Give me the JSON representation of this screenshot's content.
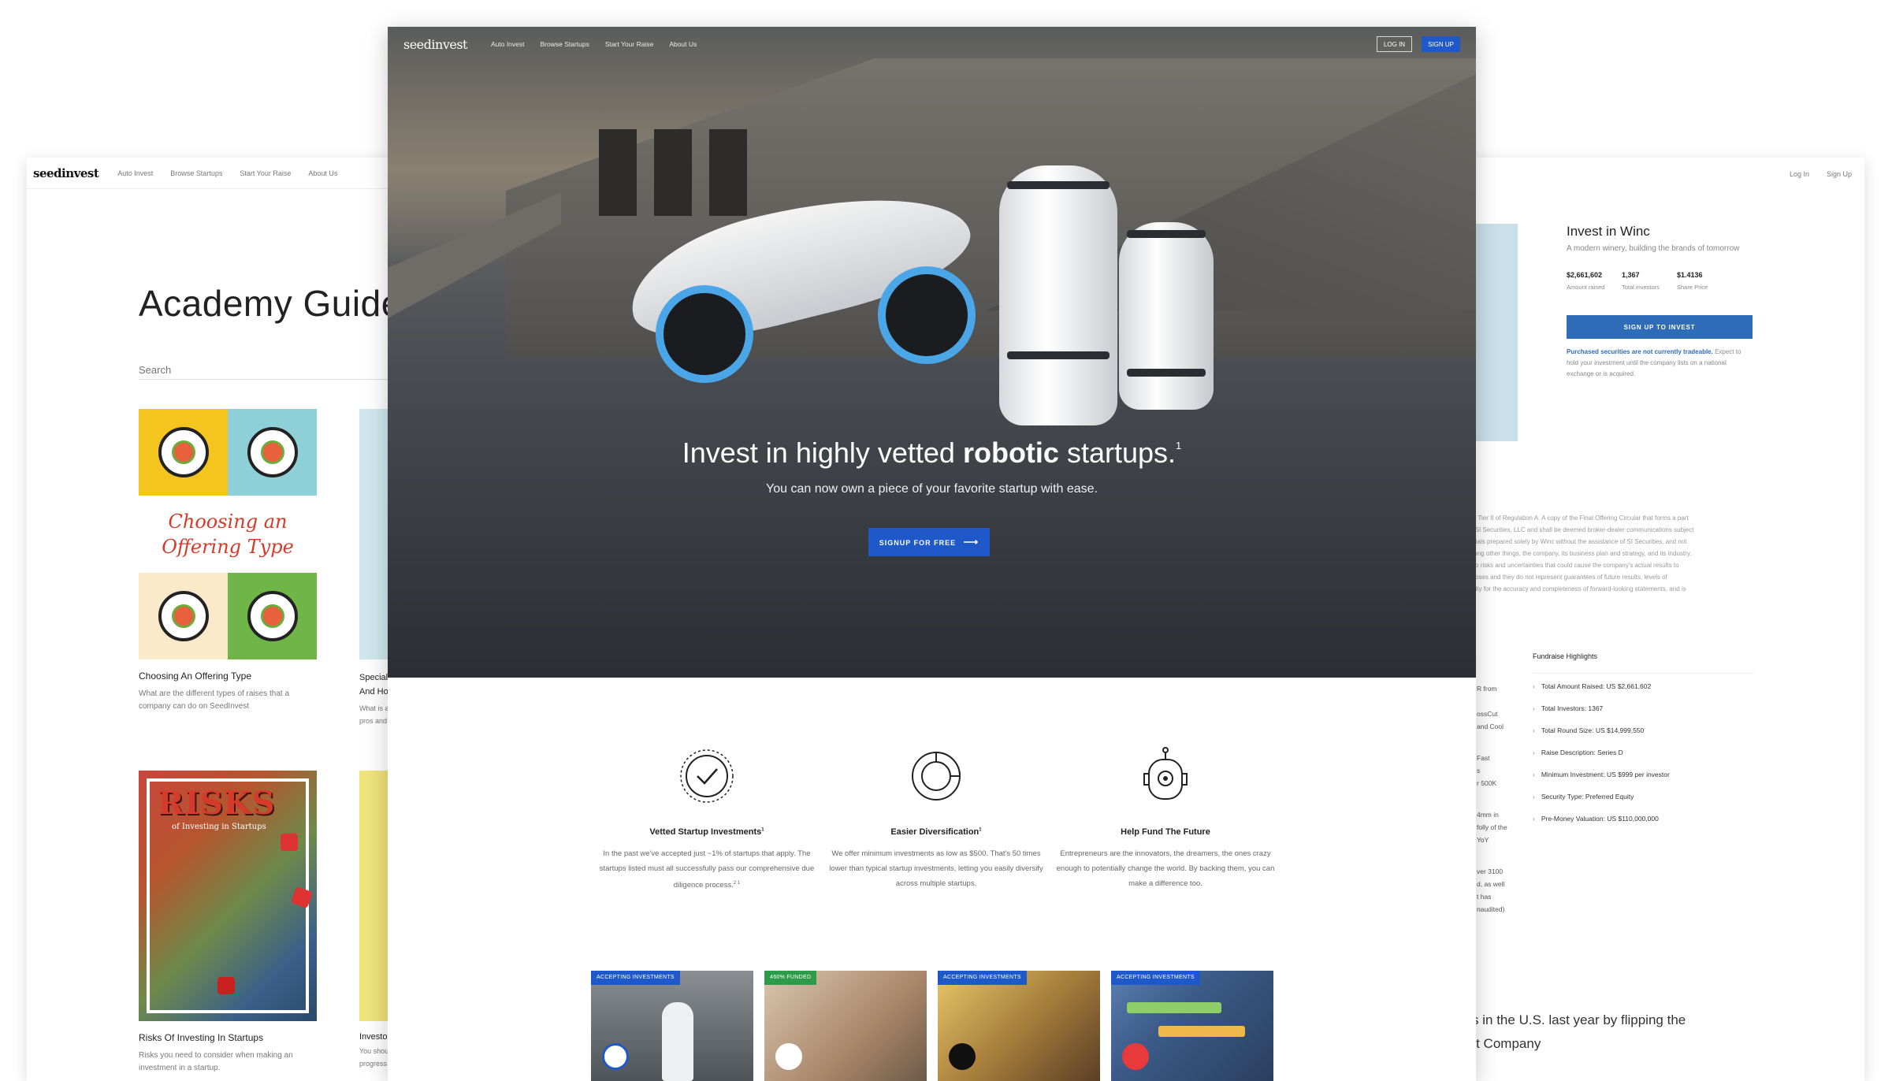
{
  "brand": {
    "logo": "seedinvest"
  },
  "left_window": {
    "nav": [
      "Auto Invest",
      "Browse Startups",
      "Start Your Raise",
      "About Us"
    ],
    "title": "Academy Guides",
    "search_placeholder": "Search",
    "guides": [
      {
        "title": "Choosing An Offering Type",
        "desc": "What are the different types of raises that a company can do on SeedInvest",
        "art_text": [
          "Choosing an",
          "Offering Type"
        ]
      },
      {
        "title": "Risks Of Investing In Startups",
        "desc": "Risks you need to consider when making an investment in a startup.",
        "art_text": [
          "RISKS",
          "of Investing in Startups"
        ]
      }
    ],
    "peek_cards": [
      {
        "title_lines": [
          "Special",
          "And Ho"
        ],
        "desc_lines": [
          "What is a",
          "pros and"
        ]
      },
      {
        "title_lines": [
          "Investo"
        ],
        "desc_lines": [
          "You shou",
          "progress"
        ]
      }
    ]
  },
  "center_window": {
    "nav": [
      "Auto Invest",
      "Browse Startups",
      "Start Your Raise",
      "About Us"
    ],
    "login_label": "LOG IN",
    "signup_label": "SIGN UP",
    "headline_pre": "Invest in highly vetted ",
    "headline_bold": "robotic",
    "headline_post": " startups.",
    "headline_sup": "1",
    "subhead": "You can now own a piece of your favorite startup with ease.",
    "cta_label": "SIGNUP FOR FREE",
    "features": [
      {
        "icon": "badge-check-icon",
        "title": "Vetted Startup Investments",
        "title_sup": "1",
        "desc": "In the past we've accepted just ~1% of startups that apply. The startups listed must all successfully pass our comprehensive due diligence process.",
        "desc_sup": "2 1"
      },
      {
        "icon": "pie-chart-icon",
        "title": "Easier Diversification",
        "title_sup": "1",
        "desc": "We offer minimum investments as low as $500. That's 50 times lower than typical startup investments, letting you easily diversify across multiple startups."
      },
      {
        "icon": "robot-icon",
        "title": "Help Fund The Future",
        "desc": "Entrepreneurs are the innovators, the dreamers, the ones crazy enough to potentially change the world. By backing them, you can make a difference too."
      }
    ],
    "deals": [
      {
        "tag": "ACCEPTING INVESTMENTS",
        "tag_color": "#1f58c8"
      },
      {
        "tag": "460% FUNDED",
        "tag_color": "#2e9b4a"
      },
      {
        "tag": "ACCEPTING INVESTMENTS",
        "tag_color": "#1f58c8"
      },
      {
        "tag": "ACCEPTING INVESTMENTS",
        "tag_color": "#1f58c8"
      }
    ]
  },
  "right_window": {
    "nav": [
      "Log In",
      "Sign Up"
    ],
    "title": "Invest in Winc",
    "subtitle": "A modern winery, building the brands of tomorrow",
    "stats": [
      {
        "value": "$2,661,602",
        "label": "Amount raised"
      },
      {
        "value": "1,367",
        "label": "Total investors"
      },
      {
        "value": "$1.4136",
        "label": "Share Price"
      }
    ],
    "cta_label": "SIGN UP TO INVEST",
    "note_bold": "Purchased securities are not currently tradeable.",
    "note_rest": " Expect to hold your investment until the company lists on a national exchange or is acquired.",
    "legal_lines": [
      "e Commission under Tier II of Regulation A. A copy of the Final Offering Circular that forms a part",
      "e been prepared by SI Securities, LLC and shall be deemed broker-dealer communications subject",
      "aining offering materials prepared solely by Winc without the assistance of SI Securities, and not",
      "ation relating to, among other things, the company, its business plan and strategy, and its industry.",
      "ble and are subject to risks and uncertainties that could cause the company's actual results to",
      "e for illustrative purposes and they do not represent guarantees of future results, levels of",
      "assumes responsibility for the accuracy and completeness of forward-looking statements, and is"
    ],
    "highlights_title": "Fundraise Highlights",
    "highlights": [
      "Total Amount Raised: US $2,661,602",
      "Total Investors: 1367",
      "Total Round Size: US $14,999,550",
      "Raise Description: Series D",
      "Minimum Investment: US $999 per investor",
      "Security Type: Preferred Equity",
      "Pre-Money Valuation: US $110,000,000"
    ],
    "fragments": [
      "R from",
      "",
      "ossCut",
      "and Cool",
      "",
      "Fast",
      "s",
      "r 500K",
      "",
      "4mm in",
      "folly of the",
      "YoY",
      "",
      "ver 3100",
      "d, as well",
      "t has",
      "naudited)"
    ],
    "quote_line1": "0 wineries in the U.S. last year by flipping the",
    "quote_line2": "ad.\" - Fast Company"
  }
}
